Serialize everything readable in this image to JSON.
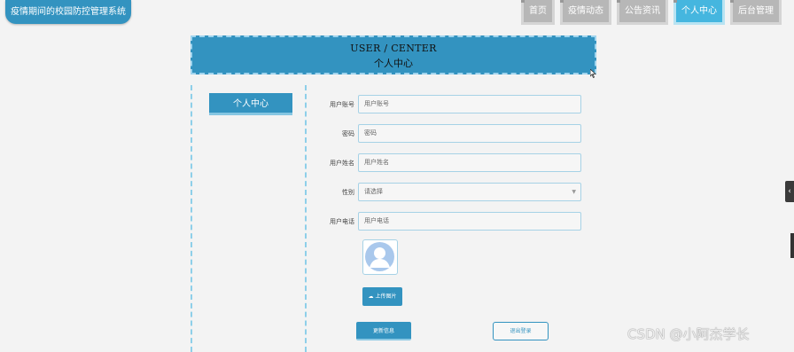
{
  "brand": {
    "title": "疫情期间的校园防控管理系统"
  },
  "nav": {
    "tabs": [
      {
        "label": "首页",
        "active": false
      },
      {
        "label": "疫情动态",
        "active": false
      },
      {
        "label": "公告资讯",
        "active": false
      },
      {
        "label": "个人中心",
        "active": true
      },
      {
        "label": "后台管理",
        "active": false
      }
    ]
  },
  "banner": {
    "title_en": "USER / CENTER",
    "title_cn": "个人中心"
  },
  "sidebar": {
    "button_label": "个人中心"
  },
  "form": {
    "fields": [
      {
        "label": "用户账号",
        "placeholder": "用户账号"
      },
      {
        "label": "密码",
        "placeholder": "密码"
      },
      {
        "label": "用户姓名",
        "placeholder": "用户姓名"
      },
      {
        "label": "性别",
        "placeholder": "请选择",
        "type": "select"
      },
      {
        "label": "用户电话",
        "placeholder": "用户电话"
      }
    ],
    "upload_label": "上传图片",
    "update_label": "更新信息",
    "logout_label": "退出登录"
  },
  "watermark": "CSDN @小阿杰学长",
  "side_tab_icon": "‹",
  "colors": {
    "primary": "#3393c0",
    "active_tab": "#45b6df",
    "tab": "#b7b7b7",
    "dashed": "#8ecfe9"
  }
}
